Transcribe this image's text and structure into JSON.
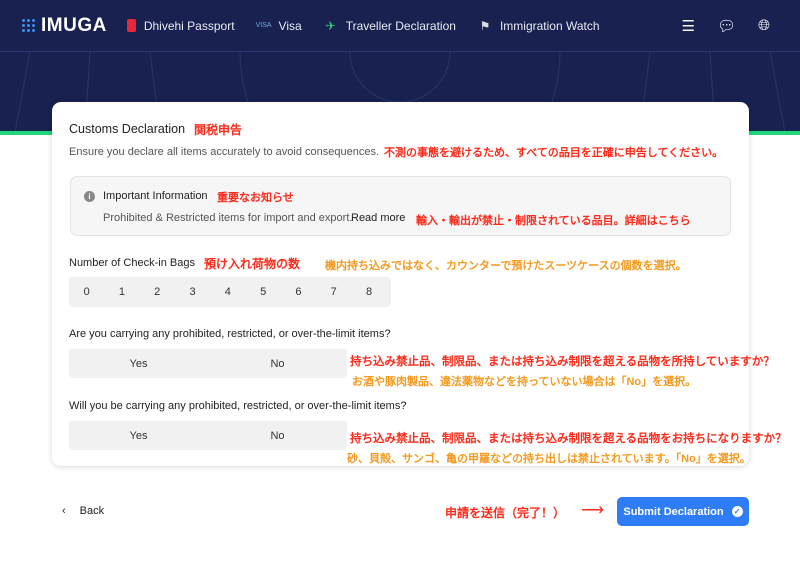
{
  "nav": {
    "logo": "IMUGA",
    "items": [
      {
        "label": "Dhivehi Passport",
        "icon": "passport-icon"
      },
      {
        "label": "Visa",
        "icon": "visa-icon"
      },
      {
        "label": "Traveller Declaration",
        "icon": "airplane-icon"
      },
      {
        "label": "Immigration Watch",
        "icon": "flag-icon"
      }
    ],
    "right_icons": [
      "database-icon",
      "chat-icon",
      "globe-icon"
    ]
  },
  "card": {
    "title": "Customs Declaration",
    "title_ja": "関税申告",
    "subtitle": "Ensure you declare all items accurately to avoid consequences.",
    "subtitle_ja": "不測の事態を避けるため、すべての品目を正確に申告してください。",
    "info": {
      "title": "Important Information",
      "title_ja": "重要なお知らせ",
      "text": "Prohibited & Restricted items for import and export.",
      "link": "Read more",
      "text_ja": "輸入・輸出が禁止・制限されている品目。詳細はこちら"
    },
    "bags": {
      "label": "Number of Check-in Bags",
      "label_ja": "預け入れ荷物の数",
      "note_ja": "機内持ち込みではなく、カウンターで預けたスーツケースの個数を選択。",
      "options": [
        "0",
        "1",
        "2",
        "3",
        "4",
        "5",
        "6",
        "7",
        "8"
      ]
    },
    "q1": {
      "label": "Are you carrying any prohibited, restricted, or over-the-limit items?",
      "yes": "Yes",
      "no": "No",
      "ja": "持ち込み禁止品、制限品、または持ち込み制限を超える品物を所持していますか？",
      "note_ja": "お酒や豚肉製品、違法薬物などを持っていない場合は「No」を選択。"
    },
    "q2": {
      "label": "Will you be carrying any prohibited, restricted, or over-the-limit items?",
      "yes": "Yes",
      "no": "No",
      "ja": "持ち込み禁止品、制限品、または持ち込み制限を超える品物をお持ちになりますか？",
      "note_ja": "砂、貝殻、サンゴ、亀の甲羅などの持ち出しは禁止されています。「No」を選択。"
    }
  },
  "footer": {
    "back": "Back",
    "submit_ja": "申請を送信（完了！）",
    "submit": "Submit Declaration"
  },
  "colors": {
    "nav": "#18214f",
    "accent": "#2f7df6",
    "green": "#1fd67a",
    "annotation_red": "#ff2a1a",
    "annotation_orange": "#f59a1e"
  }
}
